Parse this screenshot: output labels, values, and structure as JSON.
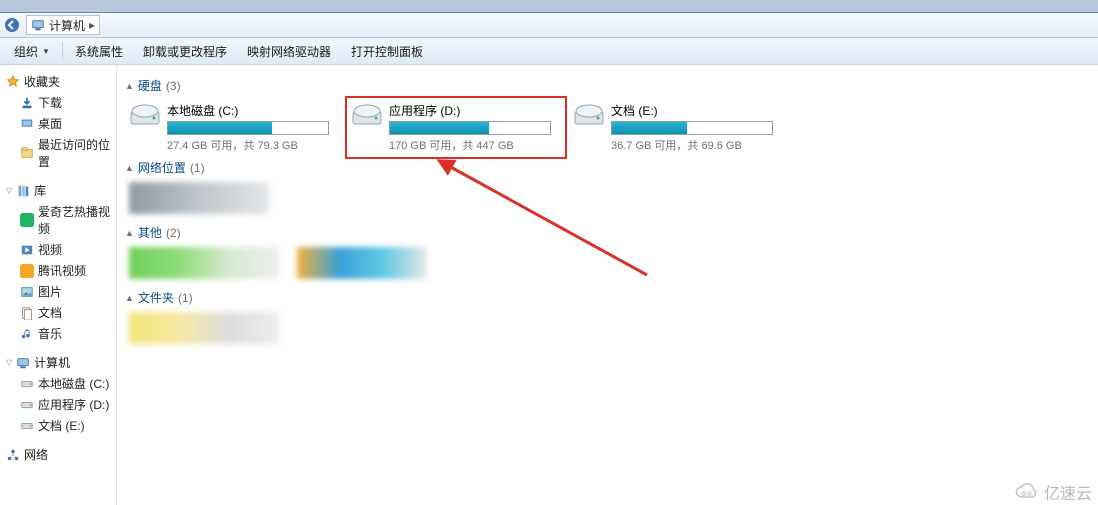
{
  "addressbar": {
    "location": "计算机",
    "chevron": "▸"
  },
  "cmdbar": {
    "organize": "组织",
    "system_props": "系统属性",
    "uninstall": "卸载或更改程序",
    "map_drive": "映射网络驱动器",
    "control_panel": "打开控制面板"
  },
  "sidebar": {
    "favorites": {
      "label": "收藏夹",
      "items": [
        {
          "label": "下载",
          "icon": "download"
        },
        {
          "label": "桌面",
          "icon": "desktop"
        },
        {
          "label": "最近访问的位置",
          "icon": "recent"
        }
      ]
    },
    "libraries": {
      "label": "库",
      "items": [
        {
          "label": "爱奇艺热播视频",
          "icon": "iqiyi"
        },
        {
          "label": "视频",
          "icon": "video"
        },
        {
          "label": "腾讯视频",
          "icon": "qq"
        },
        {
          "label": "图片",
          "icon": "pictures"
        },
        {
          "label": "文档",
          "icon": "docs"
        },
        {
          "label": "音乐",
          "icon": "music"
        }
      ]
    },
    "computer": {
      "label": "计算机",
      "items": [
        {
          "label": "本地磁盘 (C:)",
          "icon": "disk"
        },
        {
          "label": "应用程序 (D:)",
          "icon": "disk"
        },
        {
          "label": "文档 (E:)",
          "icon": "disk"
        }
      ]
    },
    "network": {
      "label": "网络"
    }
  },
  "groups": {
    "disks": {
      "title": "硬盘",
      "count": "(3)",
      "items": [
        {
          "name": "本地磁盘 (C:)",
          "sub": "27.4 GB 可用，共 79.3 GB",
          "fill_pct": 65,
          "highlight": false
        },
        {
          "name": "应用程序 (D:)",
          "sub": "170 GB 可用，共 447 GB",
          "fill_pct": 62,
          "highlight": true
        },
        {
          "name": "文档 (E:)",
          "sub": "36.7 GB 可用，共 69.6 GB",
          "fill_pct": 47,
          "highlight": false
        }
      ]
    },
    "netloc": {
      "title": "网络位置",
      "count": "(1)"
    },
    "other": {
      "title": "其他",
      "count": "(2)"
    },
    "folders": {
      "title": "文件夹",
      "count": "(1)"
    }
  },
  "watermark": "亿速云"
}
